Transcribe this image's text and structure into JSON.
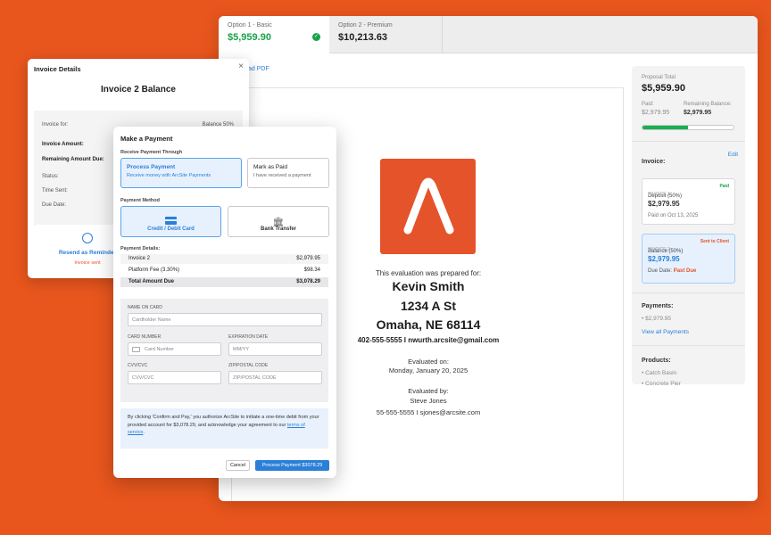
{
  "colors": {
    "brand": "#e8561d",
    "accent": "#2b7fd8",
    "success": "#19a24a",
    "danger": "#e5532a"
  },
  "options": [
    {
      "label": "Option 1 - Basic",
      "price": "$5,959.90",
      "selected": true
    },
    {
      "label": "Option 2 - Premium",
      "price": "$10,213.63",
      "selected": false
    }
  ],
  "download_link": "ad PDF",
  "document": {
    "prepared_for_label": "This evaluation was prepared for:",
    "customer_name": "Kevin Smith",
    "address_line1": "1234 A St",
    "address_line2": "Omaha, NE 68114",
    "customer_contact": "402-555-5555 I nwurth.arcsite@gmail.com",
    "evaluated_on_label": "Evaluated on:",
    "evaluated_on_date": "Monday, January 20, 2025",
    "evaluated_by_label": "Evaluated by:",
    "evaluator_name": "Steve Jones",
    "evaluator_contact": "55-555-5555 I  sjones@arcsite.com"
  },
  "sidebar": {
    "proposal_total_label": "Proposal Total",
    "proposal_total": "$5,959.90",
    "paid_label": "Paid:",
    "paid_value": "$2,979.95",
    "remaining_label": "Remaining Balance:",
    "remaining_value": "$2,979.95",
    "paid_fraction": 0.5,
    "invoice_label": "Invoice:",
    "edit_label": "Edit",
    "invoices": [
      {
        "title": "INVOICE 1",
        "status": "Paid",
        "desc": "Deposit (50%)",
        "amount": "$2,979.95",
        "note_label": "Paid on Oct 13, 2025",
        "note_value": ""
      },
      {
        "title": "INVOICE 2",
        "status": "Sent to Client",
        "desc": "Balance (50%)",
        "amount": "$2,979.95",
        "note_label": "Due Date:",
        "note_value": "Past Due"
      }
    ],
    "payments_label": "Payments:",
    "payments": [
      "$2,979.95"
    ],
    "view_all_payments": "View all Payments",
    "products_label": "Products:",
    "products": [
      "Catch Basin",
      "Concrete Pier"
    ]
  },
  "invoice_details": {
    "title": "Invoice Details",
    "close_icon": "×",
    "heading": "Invoice 2 Balance",
    "invoice_for_label": "Invoice for:",
    "invoice_for_value": "Balance 50%",
    "invoice_amount_label": "Invoice Amount:",
    "remaining_due_label": "Remaining Amount Due:",
    "status_label": "Status:",
    "time_sent_label": "Time Sent:",
    "due_date_label": "Due Date:",
    "resend_label": "Resend as Reminder",
    "invoice_sent": "Invoice sent"
  },
  "payment": {
    "title": "Make a Payment",
    "receive_label": "Receive Payment Through",
    "process_title": "Process Payment",
    "process_sub": "Receive money with ArcSite Payments",
    "mark_title": "Mark as Paid",
    "mark_sub": "I have received a payment",
    "method_label": "Payment Method",
    "method_card": "Credit / Debit Card",
    "method_bank": "Bank Transfer",
    "details_label": "Payment Details:",
    "rows": [
      {
        "label": "Invoice 2",
        "value": "$2,979.95"
      },
      {
        "label": "Platform Fee (3.30%)",
        "value": "$98.34"
      },
      {
        "label": "Total Amount Due",
        "value": "$3,078.29"
      }
    ],
    "name_label": "NAME ON CARD",
    "name_placeholder": "Cardholder Name",
    "card_label": "CARD NUMBER",
    "card_placeholder": "Card Number",
    "exp_label": "EXPIRATION DATE",
    "exp_placeholder": "MM/YY",
    "cvv_label": "CVV/CVC",
    "cvv_placeholder": "CVV/CVC",
    "zip_label": "ZIP/POSTAL CODE",
    "zip_placeholder": "ZIP/POSTAL CODE",
    "notice_text": "By clicking 'Confirm and Pay,' you authorize ArcSite to initiate a one-time debit from your provided account for $3,078.29, and acknowledge your agreement to our",
    "terms_link": "terms of service",
    "cancel_label": "Cancel",
    "pay_label": "Process Payment $3078.29"
  }
}
